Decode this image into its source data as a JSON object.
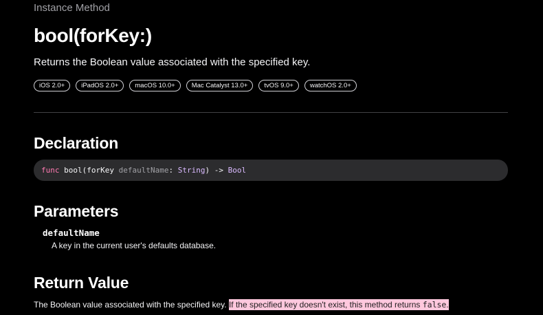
{
  "header": {
    "eyebrow": "Instance Method",
    "title": "bool(forKey:)",
    "abstract": "Returns the Boolean value associated with the specified key."
  },
  "platforms": [
    "iOS 2.0+",
    "iPadOS 2.0+",
    "macOS 10.0+",
    "Mac Catalyst 13.0+",
    "tvOS 9.0+",
    "watchOS 2.0+"
  ],
  "declaration": {
    "heading": "Declaration",
    "keyword": "func",
    "fn_name": "bool(",
    "label": "forKey",
    "param": "defaultName",
    "colon": ": ",
    "param_type": "String",
    "arrow": ") -> ",
    "return_type": "Bool"
  },
  "parameters": {
    "heading": "Parameters",
    "items": [
      {
        "name": "defaultName",
        "description": "A key in the current user's defaults database."
      }
    ]
  },
  "return_value": {
    "heading": "Return Value",
    "text": "The Boolean value associated with the specified key. ",
    "highlighted_text": "If the specified key doesn't exist, this method returns ",
    "code": "false",
    "period": "."
  },
  "colors": {
    "background": "#000000",
    "keyword": "#ff7ab2",
    "type": "#dabaff",
    "highlight": "#ffc8dd",
    "code_background": "#2c2c2e"
  }
}
